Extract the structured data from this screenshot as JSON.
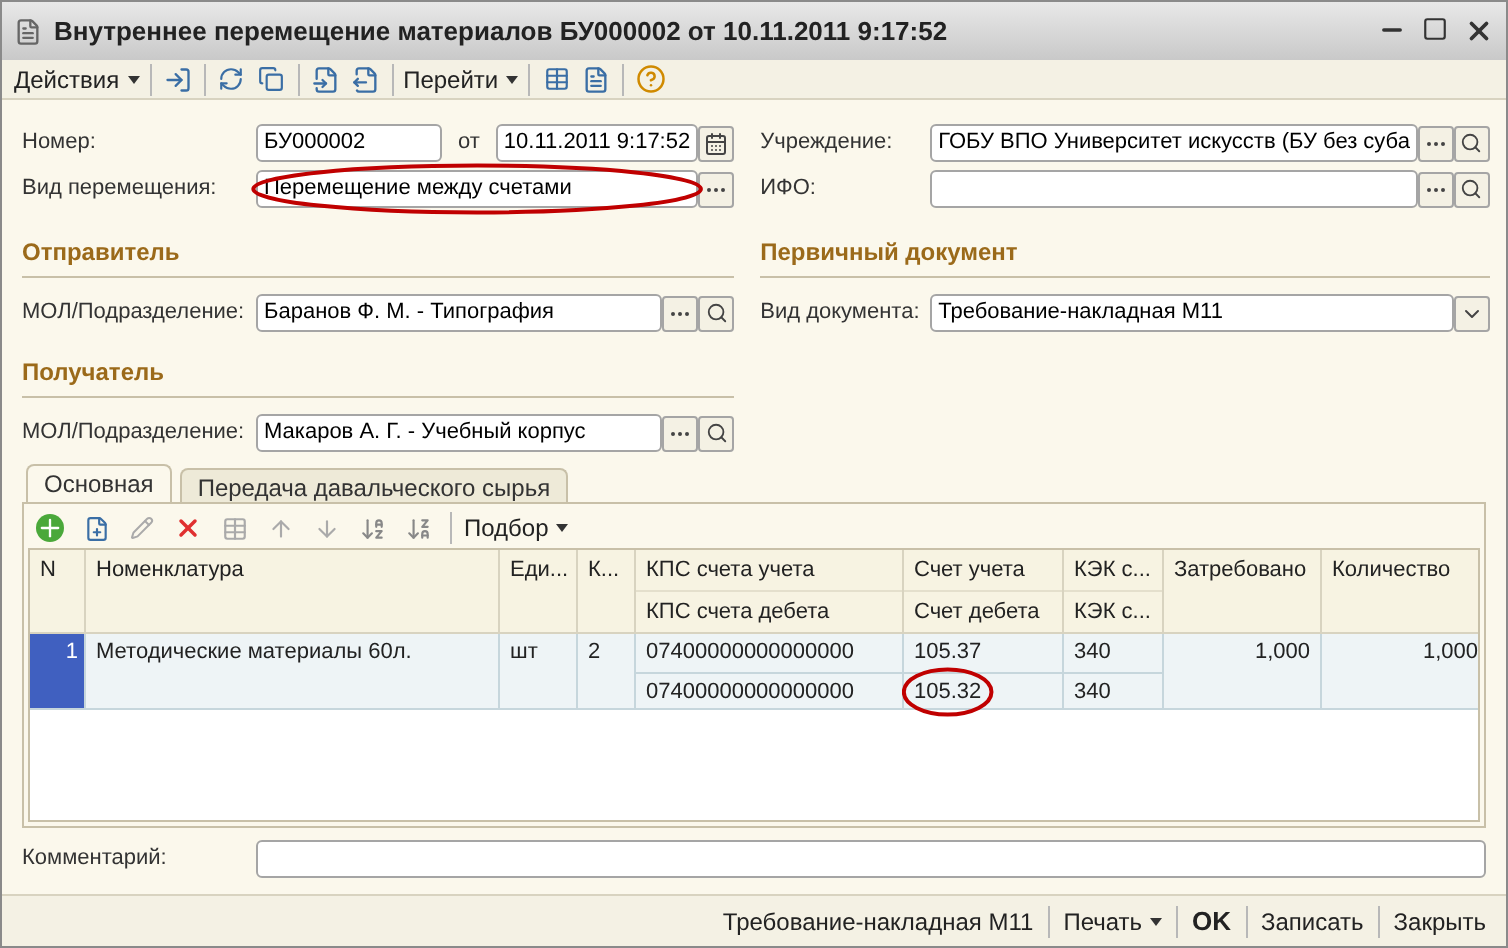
{
  "window": {
    "title": "Внутреннее перемещение материалов БУ000002 от 10.11.2011 9:17:52"
  },
  "toolbar": {
    "actions": "Действия",
    "goto": "Перейти"
  },
  "number": {
    "label": "Номер:",
    "value": "БУ000002"
  },
  "date": {
    "label": "от",
    "value": "10.11.2011  9:17:52"
  },
  "movement_type": {
    "label": "Вид перемещения:",
    "value": "Перемещение между счетами",
    "circled": true
  },
  "institution": {
    "label": "Учреждение:",
    "value": "ГОБУ ВПО Университет искусств (БУ без суба"
  },
  "ifo": {
    "label": "ИФО:"
  },
  "sender": {
    "title": "Отправитель",
    "label": "МОЛ/Подразделение:",
    "value": "Баранов Ф. М. - Типография"
  },
  "primary_document": {
    "title": "Первичный документ",
    "label": "Вид документа:",
    "value": "Требование-накладная М11"
  },
  "receiver": {
    "title": "Получатель",
    "label": "МОЛ/Подразделение:",
    "value": "Макаров А. Г. - Учебный корпус"
  },
  "tabs": [
    {
      "label": "Основная",
      "selected": true
    },
    {
      "label": "Передача давальческого сырья",
      "selected": false
    }
  ],
  "table_toolbar": {
    "selection": "Подбор"
  },
  "table": {
    "columns": [
      {
        "label": "N",
        "kind": "number"
      },
      {
        "label": "Номенклатура"
      },
      {
        "label": "Еди..."
      },
      {
        "label": "К..."
      },
      {
        "label": "КПС счета учета",
        "sublabel": "КПС счета дебета"
      },
      {
        "label": "Счет учета",
        "sublabel": "Счет дебета"
      },
      {
        "label": "КЭК с...",
        "sublabel": "КЭК с..."
      },
      {
        "label": "Затребовано",
        "kind": "number"
      },
      {
        "label": "Количество",
        "kind": "number"
      }
    ],
    "rows": [
      {
        "selected": true,
        "cells": [
          {
            "value": "1"
          },
          {
            "value": "Методические материалы 60л."
          },
          {
            "value": "шт"
          },
          {
            "value": "2"
          },
          {
            "value": "07400000000000000",
            "value2": "07400000000000000"
          },
          {
            "value": "105.37",
            "value2": "105.32",
            "circled2": true
          },
          {
            "value": "340",
            "value2": "340"
          },
          {
            "value": "1,000"
          },
          {
            "value": "1,000"
          }
        ]
      }
    ]
  },
  "comment": {
    "label": "Комментарий:"
  },
  "footer": {
    "buttons": [
      {
        "label": "Требование-накладная М11",
        "kind": "plain"
      },
      {
        "label": "Печать",
        "kind": "menu"
      },
      {
        "label": "OK",
        "kind": "default"
      },
      {
        "label": "Записать",
        "kind": "plain"
      },
      {
        "label": "Закрыть",
        "kind": "plain"
      }
    ]
  }
}
